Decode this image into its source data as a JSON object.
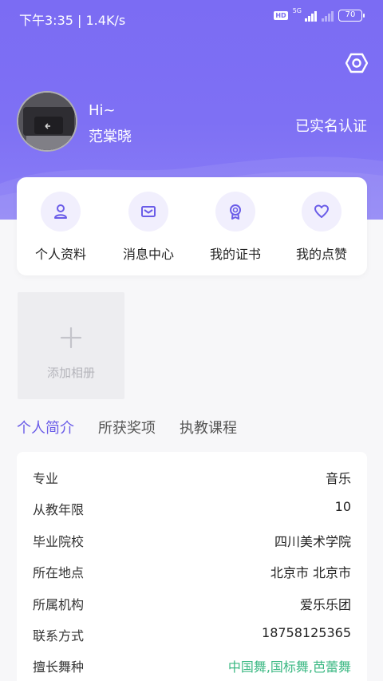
{
  "status_bar": {
    "time": "下午3:35 | 1.4K/s",
    "hd": "HD",
    "network": "5G",
    "battery": "70"
  },
  "header": {
    "greeting": "Hi~",
    "username": "范棠晓",
    "verified_label": "已实名认证",
    "icons": {
      "settings": "settings-hexagon-icon"
    }
  },
  "menu": [
    {
      "label": "个人资料",
      "icon": "user-icon"
    },
    {
      "label": "消息中心",
      "icon": "mail-icon"
    },
    {
      "label": "我的证书",
      "icon": "award-icon"
    },
    {
      "label": "我的点赞",
      "icon": "heart-icon"
    }
  ],
  "album": {
    "add_label": "添加相册"
  },
  "tabs": [
    {
      "label": "个人简介",
      "active": true
    },
    {
      "label": "所获奖项",
      "active": false
    },
    {
      "label": "执教课程",
      "active": false
    }
  ],
  "profile": [
    {
      "key": "专业",
      "value": "音乐"
    },
    {
      "key": "从教年限",
      "value": "10"
    },
    {
      "key": "毕业院校",
      "value": "四川美术学院"
    },
    {
      "key": "所在地点",
      "value": "北京市 北京市"
    },
    {
      "key": "所属机构",
      "value": "爱乐乐团"
    },
    {
      "key": "联系方式",
      "value": "18758125365"
    },
    {
      "key": "擅长舞种",
      "value": "中国舞,国标舞,芭蕾舞"
    }
  ],
  "colors": {
    "accent": "#6a5ce8",
    "hero": "#7b6cf3",
    "highlight_value": "#3bb883"
  }
}
